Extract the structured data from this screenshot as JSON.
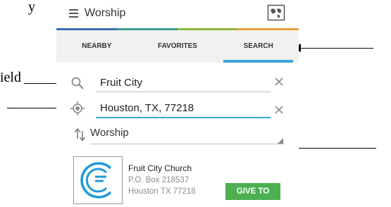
{
  "doc": {
    "fragment_top": "y",
    "fragment_field": "ield"
  },
  "app": {
    "title": "Worship",
    "icons": {
      "menu": "hamburger-menu-icon",
      "map": "map-icon"
    },
    "accent_colors": [
      "#3a6fb0",
      "#3a9a8c",
      "#8fb83a",
      "#f0a040"
    ]
  },
  "tabs": [
    {
      "label": "NEARBY",
      "active": false
    },
    {
      "label": "FAVORITES",
      "active": false
    },
    {
      "label": "SEARCH",
      "active": true
    }
  ],
  "search": {
    "name_value": "Fruit City",
    "location_value": "Houston, TX, 77218",
    "type_value": "Worship"
  },
  "result": {
    "name": "Fruit City Church",
    "address_line1": "P.O. Box 218537",
    "address_line2": "Houston TX 77218",
    "give_label": "GIVE TO",
    "colors": {
      "logo": "#1e9ad6",
      "give": "#4caf50"
    }
  }
}
